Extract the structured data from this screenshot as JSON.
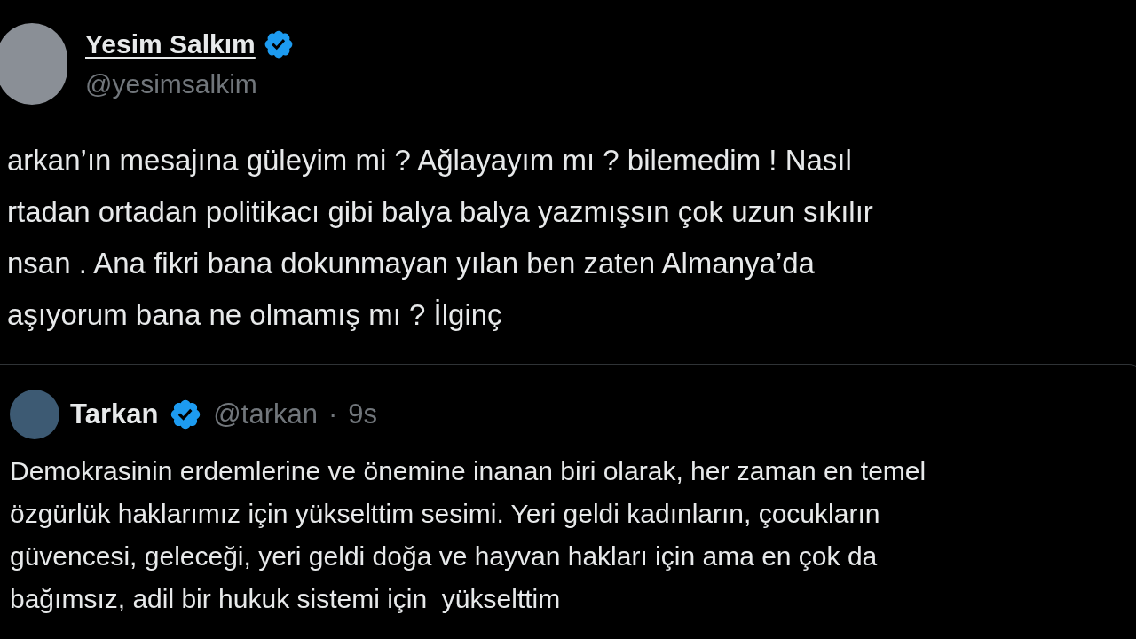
{
  "author": {
    "name": "Yesim Salkım",
    "verified": true,
    "handle": "@yesimsalkim"
  },
  "text_lines": [
    "arkan’ın mesajına güleyim mi ? Ağlayayım mı ? bilemedim ! Nasıl",
    "rtadan ortadan politikacı gibi balya balya yazmışsın çok uzun sıkılır",
    "nsan . Ana fikri bana dokunmayan yılan ben zaten Almanya’da",
    "aşıyorum bana ne olmamış mı ? İlginç"
  ],
  "quoted_post": {
    "name": "Tarkan",
    "verified": true,
    "handle": "@tarkan",
    "separator": "·",
    "time": "9s",
    "text_lines": [
      "Demokrasinin erdemlerine ve önemine inanan biri olarak, her zaman en temel",
      "özgürlük haklarımız için yükselttim sesimi. Yeri geldi kadınların, çocukların",
      "güvencesi, geleceği, yeri geldi doğa ve hayvan hakları için ama en çok da",
      "bağımsız, adil bir hukuk sistemi için  yükselttim"
    ]
  }
}
